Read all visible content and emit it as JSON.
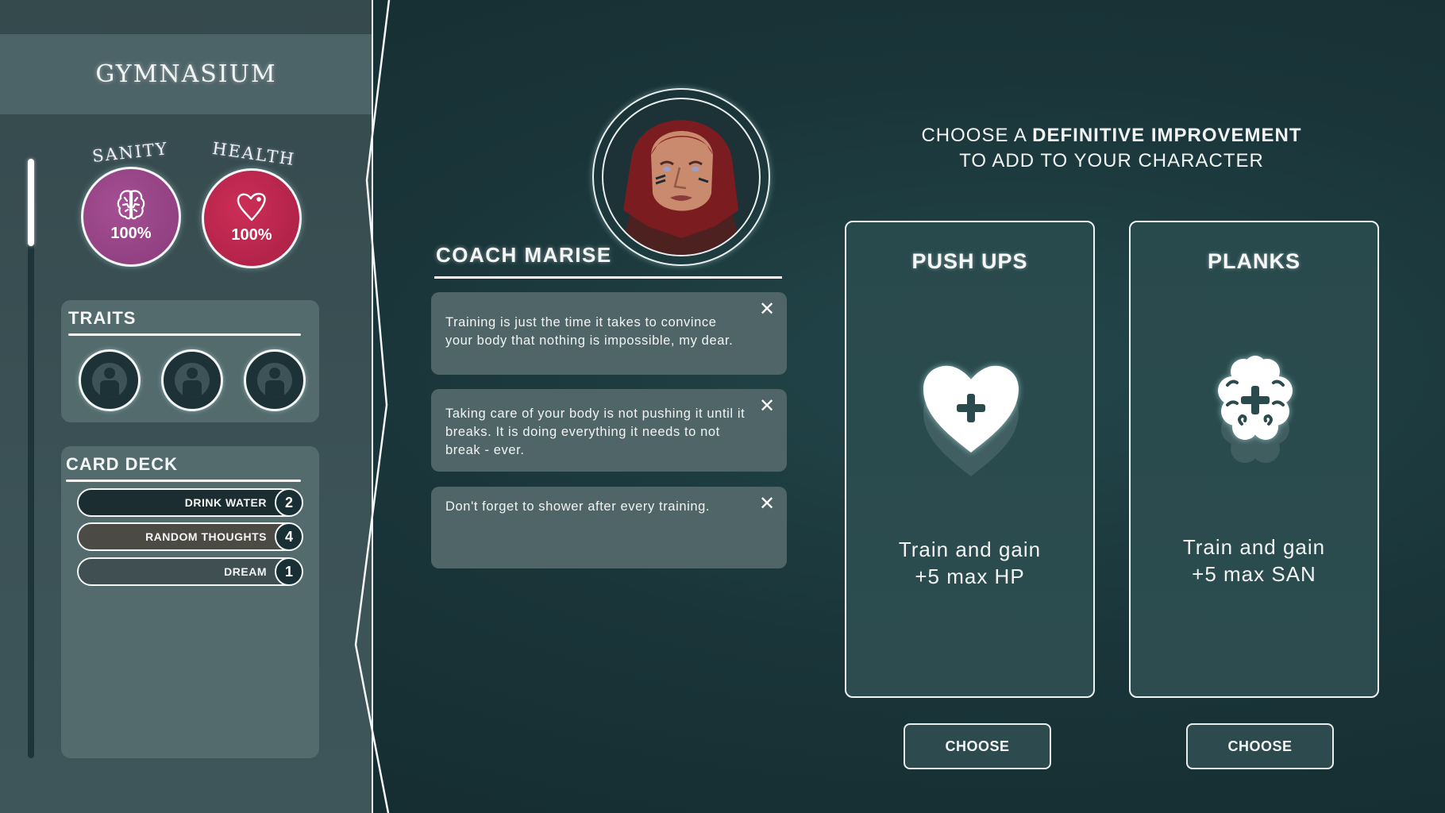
{
  "location": {
    "title": "GYMNASIUM"
  },
  "stats": {
    "sanity": {
      "label": "SANITY",
      "value": "100%",
      "percent": 100,
      "color": "#9c4a8c",
      "icon": "brain-icon"
    },
    "health": {
      "label": "HEALTH",
      "value": "100%",
      "percent": 100,
      "color": "#c0284f",
      "icon": "heart-icon"
    }
  },
  "traits": {
    "title": "TRAITS",
    "slots": [
      {
        "icon": "empty-trait-person-icon"
      },
      {
        "icon": "empty-trait-person-icon"
      },
      {
        "icon": "empty-trait-person-icon"
      }
    ]
  },
  "card_deck": {
    "title": "CARD DECK",
    "items": [
      {
        "name": "DRINK WATER",
        "count": "2",
        "tint": "#1b2d31"
      },
      {
        "name": "RANDOM THOUGHTS",
        "count": "4",
        "tint": "#4b4a44"
      },
      {
        "name": "DREAM",
        "count": "1",
        "tint": "#3f4f52"
      }
    ]
  },
  "coach": {
    "name": "COACH MARISE",
    "dialogs": [
      {
        "text": "Training is just the time it takes to convince your body that nothing is impossible, my dear.",
        "close_icon": "close-icon"
      },
      {
        "text": "Taking care of your body is not pushing it until it breaks. It is doing everything it needs to not break - ever.",
        "close_icon": "close-icon"
      },
      {
        "text": "Don't forget to shower after every training.",
        "close_icon": "close-icon"
      }
    ]
  },
  "prompt": {
    "line1_prefix": "CHOOSE A ",
    "line1_bold": "DEFINITIVE IMPROVEMENT",
    "line2": "TO ADD TO YOUR CHARACTER"
  },
  "choices": [
    {
      "title": "PUSH UPS",
      "icon": "heart-plus-icon",
      "desc_line1": "Train and gain",
      "desc_line2": "+5 max HP",
      "button": "CHOOSE"
    },
    {
      "title": "PLANKS",
      "icon": "brain-plus-icon",
      "desc_line1": "Train and gain",
      "desc_line2": "+5 max SAN",
      "button": "CHOOSE"
    }
  ]
}
